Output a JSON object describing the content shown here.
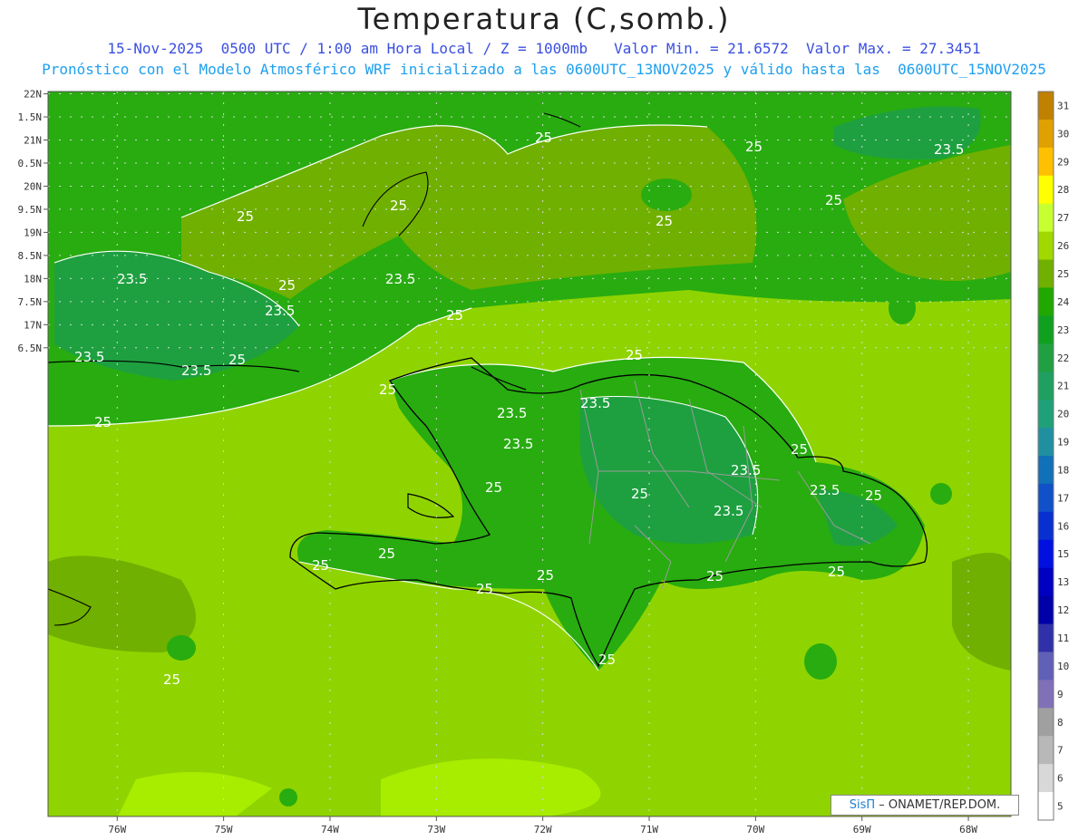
{
  "title": "Temperatura (C,somb.)",
  "subtitle_line1": "15-Nov-2025  0500 UTC / 1:00 am Hora Local / Z = 1000mb   Valor Min. = 21.6572  Valor Max. = 27.3451",
  "subtitle_line2": "Pronóstico con el Modelo Atmosférico WRF inicializado a las 0600UTC_13NOV2025 y válido hasta las  0600UTC_15NOV2025",
  "credit": {
    "sis": "SisΠ",
    "org": "– ONAMET/REP.DOM."
  },
  "colors": {
    "title": "#222222",
    "subtitle1": "#3a4fe0",
    "subtitle2": "#1ea0f0",
    "ocean_base": "#8fd400",
    "coast": "#000000",
    "province_border": "#9a9a9a",
    "contour": "#ffffff"
  },
  "chart_data": {
    "type": "heatmap",
    "map_extent": {
      "lon": [
        -76.65,
        -67.6
      ],
      "lat": [
        6.35,
        22.05
      ]
    },
    "x_ticks": [
      "76W",
      "75W",
      "74W",
      "73W",
      "72W",
      "71W",
      "70W",
      "69W",
      "68W"
    ],
    "x_tick_values": [
      -76,
      -75,
      -74,
      -73,
      -72,
      -71,
      -70,
      -69,
      -68
    ],
    "y_ticks": [
      "22N",
      "1.5N",
      "21N",
      "0.5N",
      "20N",
      "9.5N",
      "19N",
      "8.5N",
      "18N",
      "7.5N",
      "17N",
      "6.5N"
    ],
    "y_tick_values": [
      22,
      21.5,
      21,
      20.5,
      20,
      19.5,
      19,
      18.5,
      18,
      17.5,
      17,
      16.5
    ],
    "grid": true,
    "colorbar": {
      "placement": "right",
      "labels": [
        "31",
        "30",
        "29",
        "28",
        "27",
        "26",
        "25",
        "24",
        "23",
        "22",
        "21",
        "20",
        "19",
        "18",
        "17",
        "16",
        "15",
        "13",
        "12",
        "11",
        "10",
        "9",
        "8",
        "7",
        "6",
        "5"
      ],
      "colors": [
        "#c08000",
        "#e0a000",
        "#ffc000",
        "#ffff00",
        "#c8ff30",
        "#a0d800",
        "#70b000",
        "#20a800",
        "#10a020",
        "#20a040",
        "#20a060",
        "#20a078",
        "#2090a0",
        "#1070b8",
        "#1050c8",
        "#0830d0",
        "#0010e0",
        "#0000c0",
        "#0000a8",
        "#3030a8",
        "#6060b8",
        "#8070b8",
        "#a0a0a0",
        "#b8b8b8",
        "#d8d8d8",
        "#ffffff"
      ]
    },
    "contour_labels": [
      "25",
      "23.5"
    ]
  }
}
